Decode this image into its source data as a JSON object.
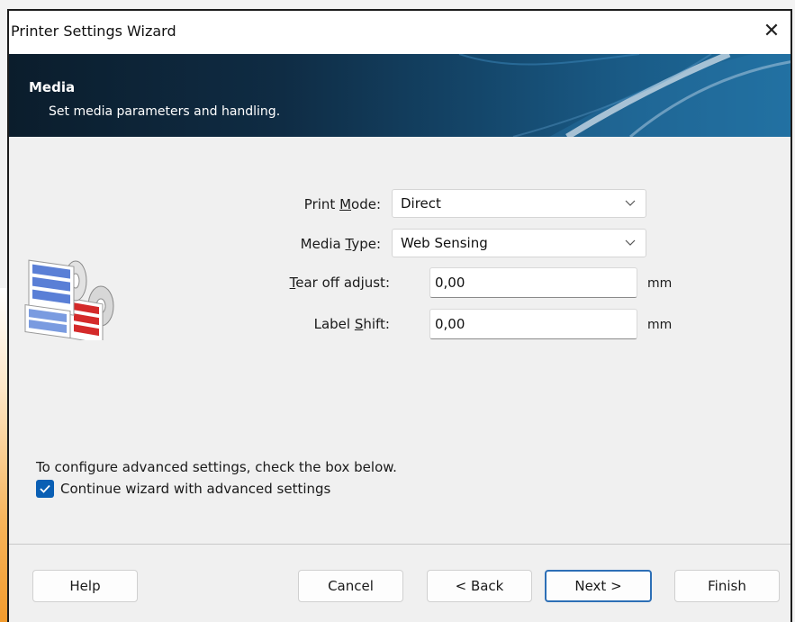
{
  "window": {
    "title": "Printer Settings Wizard",
    "close_icon": "close-icon"
  },
  "header": {
    "title": "Media",
    "subtitle": "Set media parameters and handling."
  },
  "form": {
    "print_mode": {
      "label_pre": "Print ",
      "label_mnemonic": "M",
      "label_post": "ode:",
      "value": "Direct"
    },
    "media_type": {
      "label_pre": "Media ",
      "label_mnemonic": "T",
      "label_post": "ype:",
      "value": "Web Sensing"
    },
    "tear_off_adjust": {
      "label_mnemonic": "T",
      "label_post": "ear off adjust:",
      "value": "0,00",
      "unit": "mm"
    },
    "label_shift": {
      "label_pre": "Label ",
      "label_mnemonic": "S",
      "label_post": "hift:",
      "value": "0,00",
      "unit": "mm"
    }
  },
  "advanced": {
    "instruction": "To configure advanced settings, check the box below.",
    "checkbox_label": "Continue wizard with advanced settings",
    "checked": true
  },
  "buttons": {
    "help": "Help",
    "cancel": "Cancel",
    "back": "< Back",
    "next": "Next >",
    "finish": "Finish"
  },
  "colors": {
    "accent": "#0a5fb4",
    "header_dark": "#0b1d2c",
    "header_light": "#1e6c9c",
    "default_button_border": "#2d6fb6"
  }
}
